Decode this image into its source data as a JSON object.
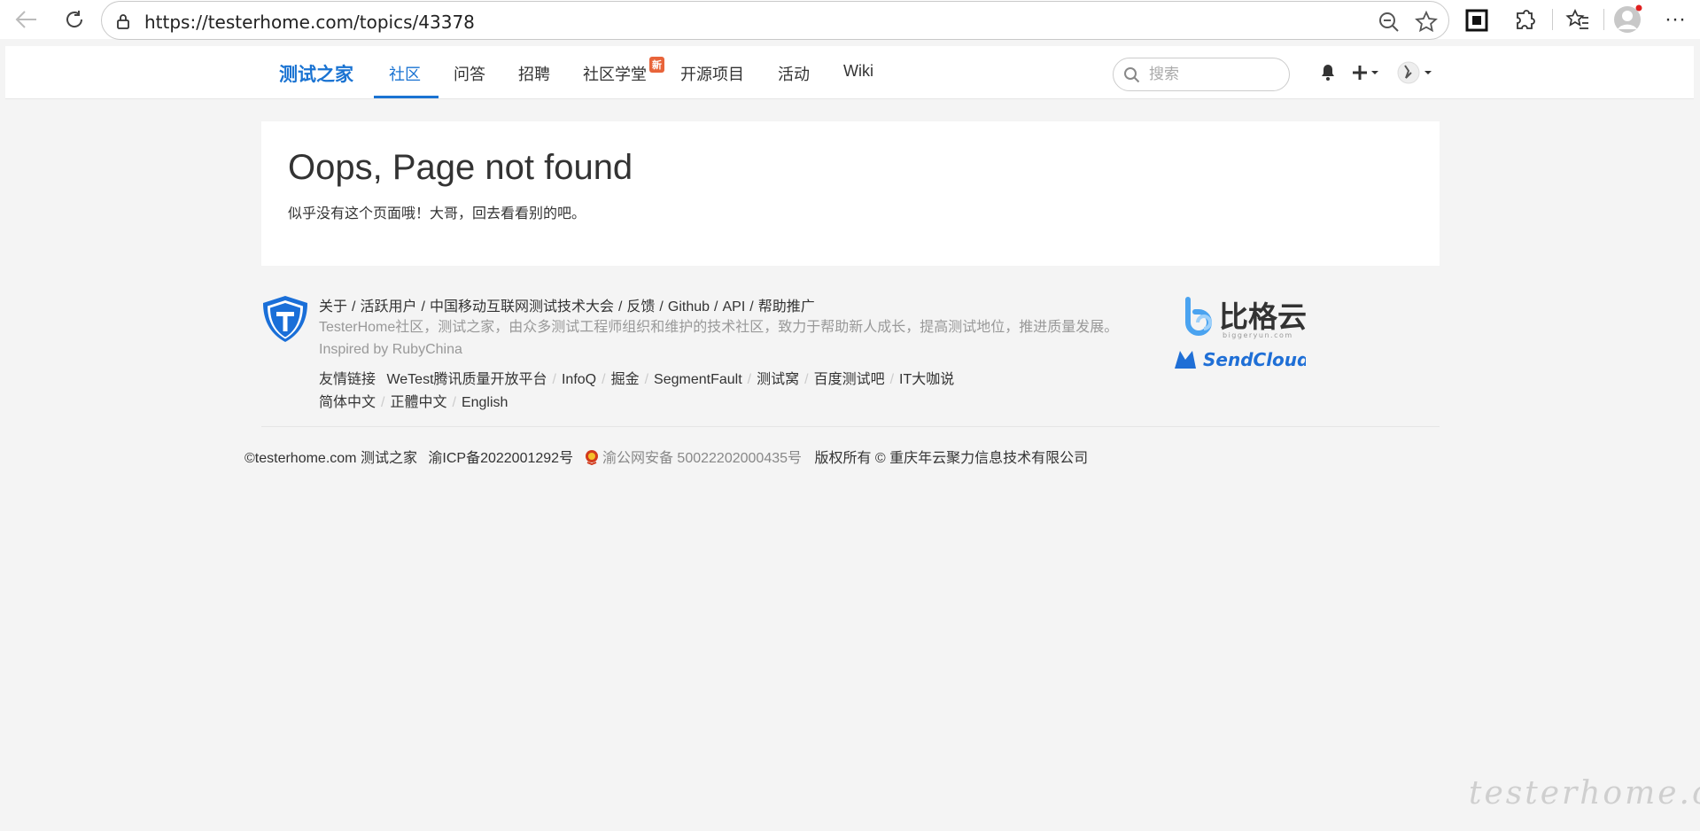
{
  "browser": {
    "url": "https://testerhome.com/topics/43378"
  },
  "nav": {
    "brand": "测试之家",
    "items": [
      {
        "label": "社区"
      },
      {
        "label": "问答"
      },
      {
        "label": "招聘"
      },
      {
        "label": "社区学堂"
      },
      {
        "label": "开源项目"
      },
      {
        "label": "活动"
      },
      {
        "label": "Wiki"
      }
    ],
    "active_index": 0,
    "new_badge": "新",
    "search_placeholder": "搜索"
  },
  "main": {
    "title": "Oops, Page not found",
    "subtitle": "似乎没有这个页面哦！大哥，回去看看别的吧。"
  },
  "footer": {
    "links": [
      "关于",
      "活跃用户",
      "中国移动互联网测试技术大会",
      "反馈",
      "Github",
      "API",
      "帮助推广"
    ],
    "link_separator": "/",
    "description": "TesterHome社区，测试之家，由众多测试工程师组织和维护的技术社区，致力于帮助新人成长，提高测试地位，推进质量发展。Inspired by RubyChina",
    "friend_label": "友情链接",
    "friend_links": [
      "WeTest腾讯质量开放平台",
      "InfoQ",
      "掘金",
      "SegmentFault",
      "测试窝",
      "百度测试吧",
      "IT大咖说"
    ],
    "languages": [
      "简体中文",
      "正體中文",
      "English"
    ],
    "sponsors": {
      "biggeryun_cn": "比格云",
      "biggeryun_en": "biggeryun.com",
      "sendcloud": "SendCloud"
    },
    "copyright": "©testerhome.com 测试之家",
    "icp": "渝ICP备2022001292号",
    "police": "渝公网安备 50022202000435号",
    "rights": "版权所有 © 重庆年云聚力信息技术有限公司"
  },
  "watermark": "testerhome.com",
  "colors": {
    "accent": "#1a73d2",
    "badge": "#e8643a"
  }
}
